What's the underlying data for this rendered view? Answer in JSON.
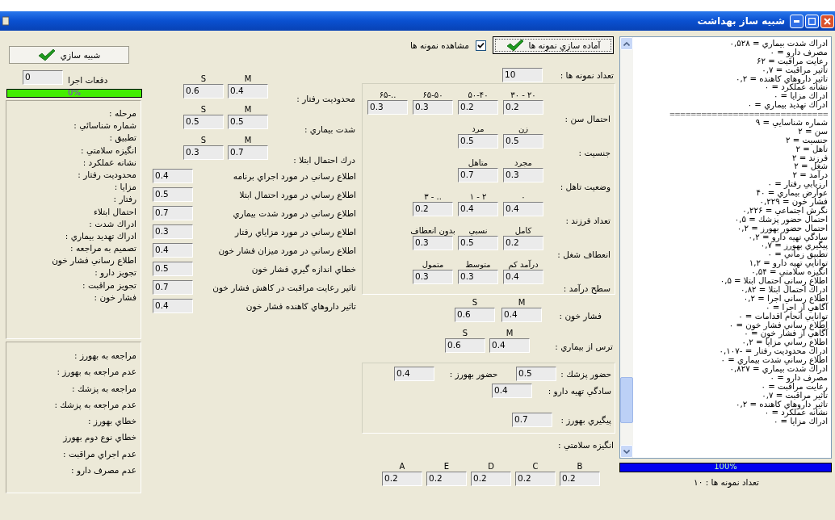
{
  "window": {
    "title": "شبيه ساز بهداشت"
  },
  "output_list": {
    "lines": [
      "ادراك شدت بيماري = ۰,۵۲۸",
      "مصرف دارو = ۰",
      "رعايت مراقبت = ۶۲",
      "تاثير مراقبت = ۰,۷",
      "تاثير داروهاي كاهنده = ۰,۲",
      "نشانه عملكرد = ۰",
      "ادراك مزايا = ۰",
      "ادراك تهديد بيماري = ۰",
      "==============================",
      "شماره شناسايي = ۹",
      "سن = ۲",
      "جنسيت = ۲",
      "تاهل = ۲",
      "فرزند = ۲",
      "شغل = ۲",
      "درآمد = ۲",
      "ارزيابي رفتار = ۰",
      "عوارض بيماري = ۴۰",
      "فشار خون = ۰,۲۲۹",
      "نگرش اجتماعي = ۰,۲۲۶",
      "احتمال حضور پزشك = ۰,۵",
      "احتمال حضور بهورز = ۰,۲",
      "سادگي تهيه دارو = ۰,۲",
      "پيگيري بهورز = ۰,۷",
      "تطبيق زماني = ۰",
      "توانايي تهيه دارو = ۱,۲",
      "انگيزه سلامتي = ۰,۵۴",
      "اطلاع رساني احتمال ابتلا = ۰,۵",
      "ادراك احتمال ابتلا = ۰,۸۲",
      "اطلاع رساني اجرا = ۰,۲",
      "آگاهي از اجرا = ۰",
      "توانايي انجام اقدامات = ۰",
      "اطلاع رساني فشار خون = ۰",
      "آگاهي از فشار خون = ۰",
      "اطلاع رساني مزايا = ۰,۲",
      "ادراك محدوديت رفتار = -۰,۱۰۷",
      "اطلاع رساني شدت بيماري = ۰",
      "ادراك شدت بيماري = ۰,۸۲۷",
      "مصرف دارو = ۰",
      "رعايت مراقبت = ۰",
      "تاثير مراقبت = ۰,۷",
      "تاثير داروهاي كاهنده = ۰,۲",
      "نشانه عملكرد = ۰",
      "ادراك مزايا = ۰"
    ],
    "progress": {
      "label": "100%",
      "level": 1
    },
    "count_label": "تعداد نمونه ها : ۱۰"
  },
  "samples": {
    "prepare_button": "آماده سازي نمونه ها",
    "show_samples": {
      "label": "مشاهده نمونه ها",
      "checked": true
    },
    "count": {
      "label": "تعداد نمونه ها :",
      "value": "10"
    }
  },
  "demographics": [
    {
      "label": "احتمال سن :",
      "headers": [
        "۲۰ - ۳۰",
        "۵۰-۴۰",
        "۶۵-۵۰",
        "..-۶۵"
      ],
      "values": [
        "0.2",
        "0.2",
        "0.3",
        "0.3"
      ]
    },
    {
      "label": "جنسيت :",
      "headers": [
        "زن",
        "مرد"
      ],
      "values": [
        "0.5",
        "0.5"
      ]
    },
    {
      "label": "وضعيت تاهل :",
      "headers": [
        "مجرد",
        "متاهل"
      ],
      "values": [
        "0.3",
        "0.7"
      ]
    },
    {
      "label": "تعداد فرزند :",
      "headers": [
        "۰",
        "۲ - ۱",
        ".. - ۳"
      ],
      "values": [
        "0.4",
        "0.4",
        "0.2"
      ]
    },
    {
      "label": "انعطاف شغل :",
      "headers": [
        "كامل",
        "نسبي",
        "بدون انعطاف"
      ],
      "values": [
        "0.2",
        "0.5",
        "0.3"
      ]
    },
    {
      "label": "سطح درآمد :",
      "headers": [
        "درآمد كم",
        "متوسط",
        "متمول"
      ],
      "values": [
        "0.4",
        "0.3",
        "0.3"
      ]
    }
  ],
  "blood_pressure": {
    "label": "فشار خون :",
    "headers": [
      "M",
      "S"
    ],
    "values": [
      "0.4",
      "0.6"
    ]
  },
  "fear": {
    "label": "ترس از بيماري :",
    "headers": [
      "M",
      "S"
    ],
    "values": [
      "0.4",
      "0.6"
    ]
  },
  "presence": {
    "doctor": {
      "label": "حضور پزشك :",
      "value": "0.5"
    },
    "health_worker": {
      "label": "حضور بهورز :",
      "value": "0.4"
    }
  },
  "drug_ease": {
    "label": "سادگي تهيه دارو :",
    "value": "0.4"
  },
  "followup": {
    "label": "پيگيري بهورز :",
    "value": "0.7"
  },
  "motivation": {
    "label": "انگيزه سلامتي :",
    "headers": [
      "B",
      "C",
      "D",
      "E",
      "A"
    ],
    "values": [
      "0.2",
      "0.2",
      "0.2",
      "0.2",
      "0.2"
    ]
  },
  "behavior_params": [
    {
      "label": "محدوديت رفتار :",
      "headers": [
        "M",
        "S"
      ],
      "values": [
        "0.4",
        "0.6"
      ]
    },
    {
      "label": "شدت بيماري :",
      "headers": [
        "M",
        "S"
      ],
      "values": [
        "0.5",
        "0.5"
      ]
    },
    {
      "label": "درك  احتمال ابتلا :",
      "headers": [
        "M",
        "S"
      ],
      "values": [
        "0.7",
        "0.3"
      ]
    }
  ],
  "info_params": [
    {
      "label": "اطلاع رساني در مورد اجراي برنامه",
      "value": "0.4"
    },
    {
      "label": "اطلاع رساني در مورد احتمال ابتلا",
      "value": "0.5"
    },
    {
      "label": "اطلاع رساني در مورد شدت بيماري",
      "value": "0.7"
    },
    {
      "label": "اطلاع رساني در مورد مزاياي رفتار",
      "value": "0.3"
    },
    {
      "label": "اطلاع رساني در مورد ميزان فشار خون",
      "value": "0.4"
    },
    {
      "label": "خطاي اندازه گيري فشار خون",
      "value": "0.5"
    },
    {
      "label": "تاثير رعايت مراقبت در كاهش فشار خون",
      "value": "0.7"
    },
    {
      "label": "تاثير داروهاي كاهنده فشار خون",
      "value": "0.4"
    }
  ],
  "simulation": {
    "button": "شبيه سازي",
    "runs": {
      "label": "دفعات اجرا",
      "value": "0"
    },
    "progress": {
      "label": "0%",
      "level": 0
    },
    "status_labels": [
      "مرحله :",
      "شماره شناسائي :",
      "تطبيق :",
      "انگيزه سلامتي :",
      "نشانه عملكرد :",
      "محدوديت رفتار :",
      "مزايا :",
      "رفتار :",
      "احتمال ابتلاء",
      "ادراك شدت :",
      "ادراك تهديد بيماري :",
      "تصميم به مراجعه :",
      "اطلاع رساني فشار خون",
      "تجويز دارو :",
      "تجويز مراقبت :",
      "فشار خون :"
    ],
    "outcome_labels": [
      "مراجعه به بهورز :",
      "عدم مراجعه به بهورز :",
      "مراجعه به پزشك :",
      "عدم مراجعه به پزشك :",
      "خطاي بهورز :",
      "خطاي نوع دوم بهورز",
      "عدم اجراي مراقبت :",
      "عدم مصرف دارو :"
    ]
  }
}
